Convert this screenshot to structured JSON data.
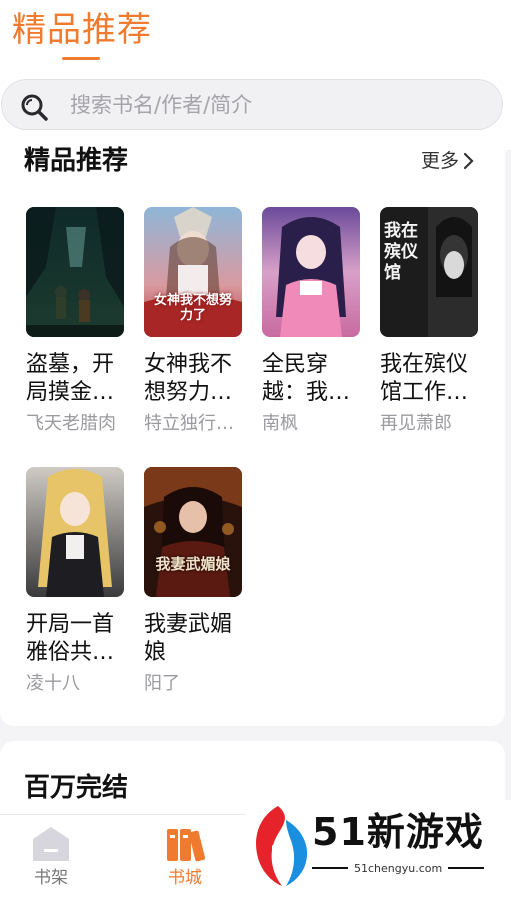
{
  "header": {
    "title": "精品推荐"
  },
  "search": {
    "placeholder": "搜索书名/作者/简介"
  },
  "section": {
    "title": "精品推荐",
    "more_label": "更多"
  },
  "books": [
    {
      "title": "盗墓，开局摸金…",
      "author": "飞天老腊肉"
    },
    {
      "title": "女神我不想努力…",
      "author": "特立独行…",
      "cover_text": "女神我不想努力了"
    },
    {
      "title": "全民穿越：我…",
      "author": "南枫"
    },
    {
      "title": "我在殡仪馆工作…",
      "author": "再见萧郎",
      "cover_text": "我在殡仪馆"
    },
    {
      "title": "开局一首雅俗共…",
      "author": "凌十八"
    },
    {
      "title": "我妻武媚娘",
      "author": "阳了",
      "cover_text": "我妻武媚娘"
    }
  ],
  "section2": {
    "title": "百万完结"
  },
  "nav": {
    "items": [
      {
        "label": "书架",
        "icon": "bookshelf-icon",
        "active": false
      },
      {
        "label": "书城",
        "icon": "bookstore-icon",
        "active": true
      }
    ]
  },
  "watermark": {
    "text": "51新游戏",
    "url": "51chengyu.com"
  },
  "colors": {
    "accent": "#f07a2e",
    "muted": "#9a9a9f"
  }
}
